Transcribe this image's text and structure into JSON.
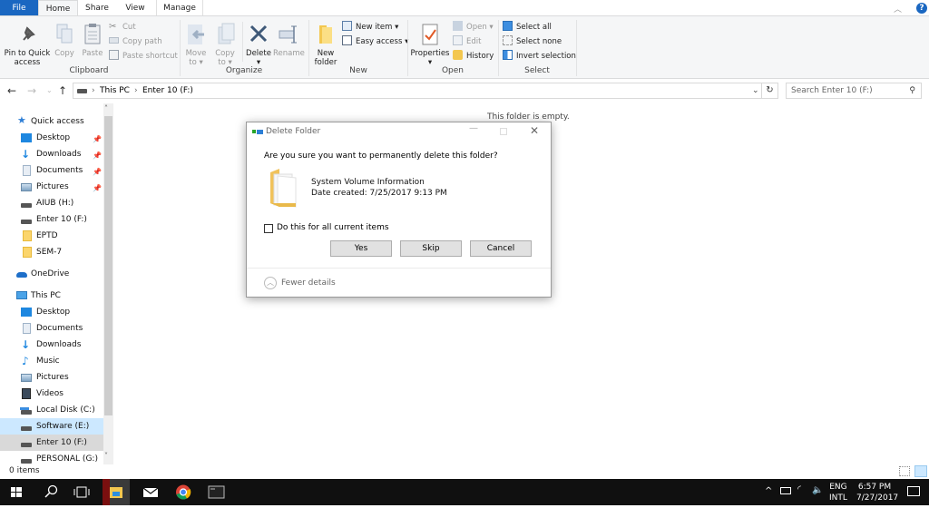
{
  "tabs": {
    "file": "File",
    "home": "Home",
    "share": "Share",
    "view": "View",
    "manage": "Manage"
  },
  "ribbon": {
    "clipboard": {
      "label": "Clipboard",
      "pin": "Pin to Quick access",
      "pin_l1": "Pin to Quick",
      "pin_l2": "access",
      "copy": "Copy",
      "paste": "Paste",
      "cut": "Cut",
      "copy_path": "Copy path",
      "paste_shortcut": "Paste shortcut"
    },
    "organize": {
      "label": "Organize",
      "move_l1": "Move",
      "move_l2": "to",
      "copy_l1": "Copy",
      "copy_l2": "to",
      "delete": "Delete",
      "rename": "Rename"
    },
    "new": {
      "label": "New",
      "new_folder_l1": "New",
      "new_folder_l2": "folder",
      "new_item": "New item",
      "easy_access": "Easy access"
    },
    "open": {
      "label": "Open",
      "properties": "Properties",
      "open": "Open",
      "edit": "Edit",
      "history": "History"
    },
    "select": {
      "label": "Select",
      "select_all": "Select all",
      "select_none": "Select none",
      "invert": "Invert selection"
    }
  },
  "address": {
    "crumbs": [
      "This PC",
      "Enter 10 (F:)"
    ],
    "search_placeholder": "Search Enter 10 (F:)"
  },
  "nav": {
    "quick_access": "Quick access",
    "quick_items": [
      {
        "label": "Desktop",
        "pinned": true
      },
      {
        "label": "Downloads",
        "pinned": true
      },
      {
        "label": "Documents",
        "pinned": true
      },
      {
        "label": "Pictures",
        "pinned": true
      },
      {
        "label": "AIUB (H:)"
      },
      {
        "label": "Enter 10 (F:)"
      },
      {
        "label": "EPTD"
      },
      {
        "label": "SEM-7"
      }
    ],
    "onedrive": "OneDrive",
    "this_pc": "This PC",
    "pc_items": [
      {
        "label": "Desktop"
      },
      {
        "label": "Documents"
      },
      {
        "label": "Downloads"
      },
      {
        "label": "Music"
      },
      {
        "label": "Pictures"
      },
      {
        "label": "Videos"
      },
      {
        "label": "Local Disk (C:)"
      },
      {
        "label": "Software (E:)"
      },
      {
        "label": "Enter 10 (F:)"
      },
      {
        "label": "PERSONAL (G:)"
      }
    ]
  },
  "content": {
    "empty_text": "This folder is empty."
  },
  "status": {
    "items": "0 items"
  },
  "dialog": {
    "title": "Delete Folder",
    "question": "Are you sure you want to permanently delete this folder?",
    "item_name": "System Volume Information",
    "item_date": "Date created: 7/25/2017 9:13 PM",
    "checkbox_label": "Do this for all current items",
    "checkbox_checked": false,
    "yes": "Yes",
    "skip": "Skip",
    "cancel": "Cancel",
    "fewer_details": "Fewer details"
  },
  "tray": {
    "lang1": "ENG",
    "lang2": "INTL",
    "time": "6:57 PM",
    "date": "7/27/2017"
  },
  "colors": {
    "accent": "#1a67c1",
    "selection": "#cce8ff",
    "taskbar": "#101010"
  }
}
